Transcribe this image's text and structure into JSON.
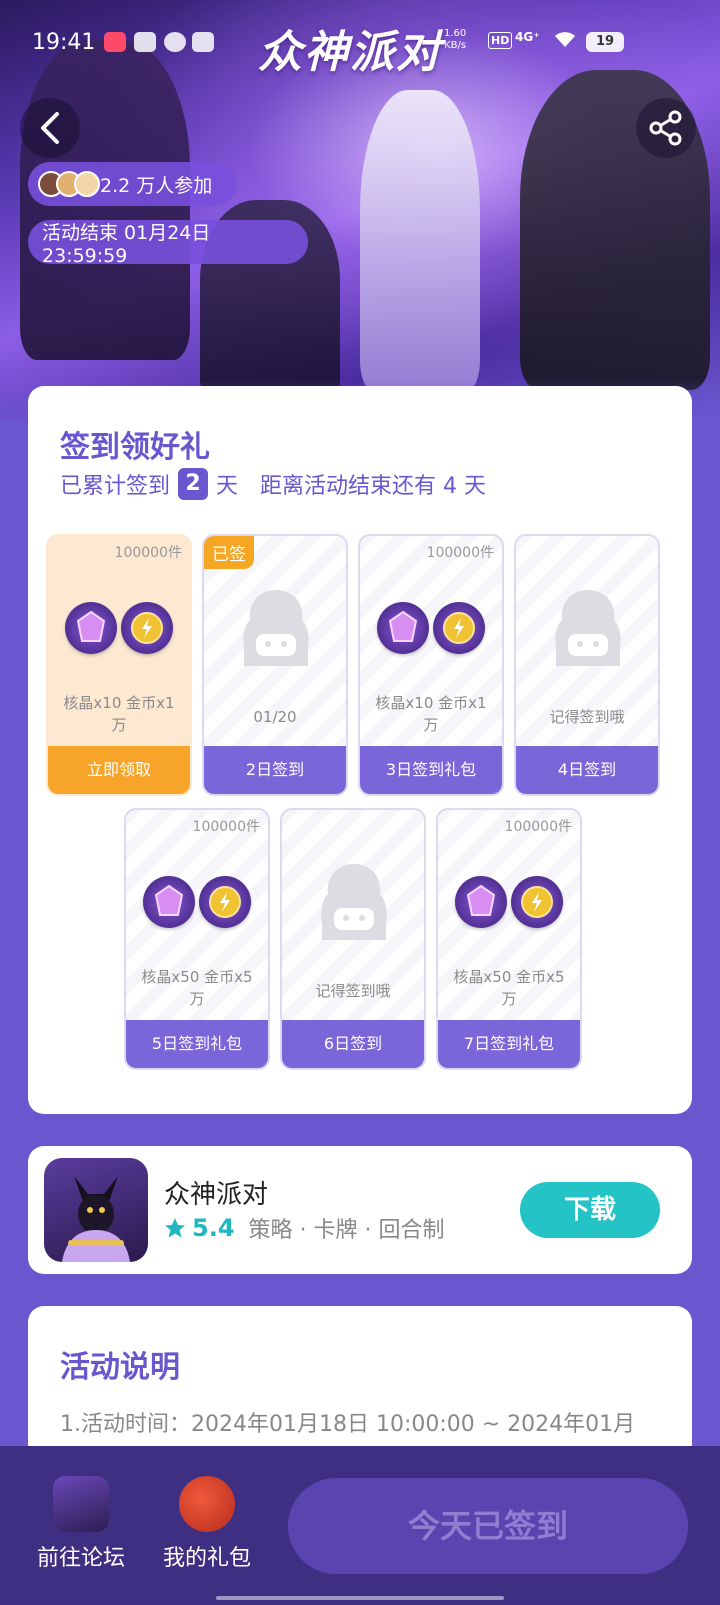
{
  "status_bar": {
    "time": "19:41",
    "net_speed_value": "1.60",
    "net_speed_unit": "KB/s",
    "hd": "HD",
    "network": "4G⁺",
    "battery": "19"
  },
  "header": {
    "logo_text": "众神派对",
    "participants": "2.2 万人参加",
    "end_time": "活动结束 01月24日 23:59:59"
  },
  "signin": {
    "title": "签到领好礼",
    "stats_prefix": "已累计签到",
    "signed_days": "2",
    "stats_day_unit": "天",
    "stats_remaining": "距离活动结束还有 4 天",
    "days": [
      {
        "qty": "100000件",
        "tag": "",
        "desc": "核晶x10 金币x1万",
        "button": "立即领取",
        "state": "claim"
      },
      {
        "qty": "",
        "tag": "已签",
        "desc": "01/20",
        "button": "2日签到",
        "state": "signed"
      },
      {
        "qty": "100000件",
        "tag": "",
        "desc": "核晶x10 金币x1万",
        "button": "3日签到礼包",
        "state": "reward"
      },
      {
        "qty": "",
        "tag": "",
        "desc": "记得签到哦",
        "button": "4日签到",
        "state": "pending"
      },
      {
        "qty": "100000件",
        "tag": "",
        "desc": "核晶x50 金币x5万",
        "button": "5日签到礼包",
        "state": "reward"
      },
      {
        "qty": "",
        "tag": "",
        "desc": "记得签到哦",
        "button": "6日签到",
        "state": "pending"
      },
      {
        "qty": "100000件",
        "tag": "",
        "desc": "核晶x50 金币x5万",
        "button": "7日签到礼包",
        "state": "reward"
      }
    ]
  },
  "app": {
    "name": "众神派对",
    "rating": "5.4",
    "tags": "策略 · 卡牌 · 回合制",
    "download_label": "下载"
  },
  "description": {
    "title": "活动说明",
    "line1": "1.活动时间：2024年01月18日 10:00:00 ~ 2024年01月"
  },
  "bottom": {
    "forum_label": "前往论坛",
    "gift_label": "我的礼包",
    "signed_label": "今天已签到"
  },
  "colors": {
    "primary": "#6a56cf",
    "claim": "#f7a52a",
    "download": "#24c3c6"
  }
}
